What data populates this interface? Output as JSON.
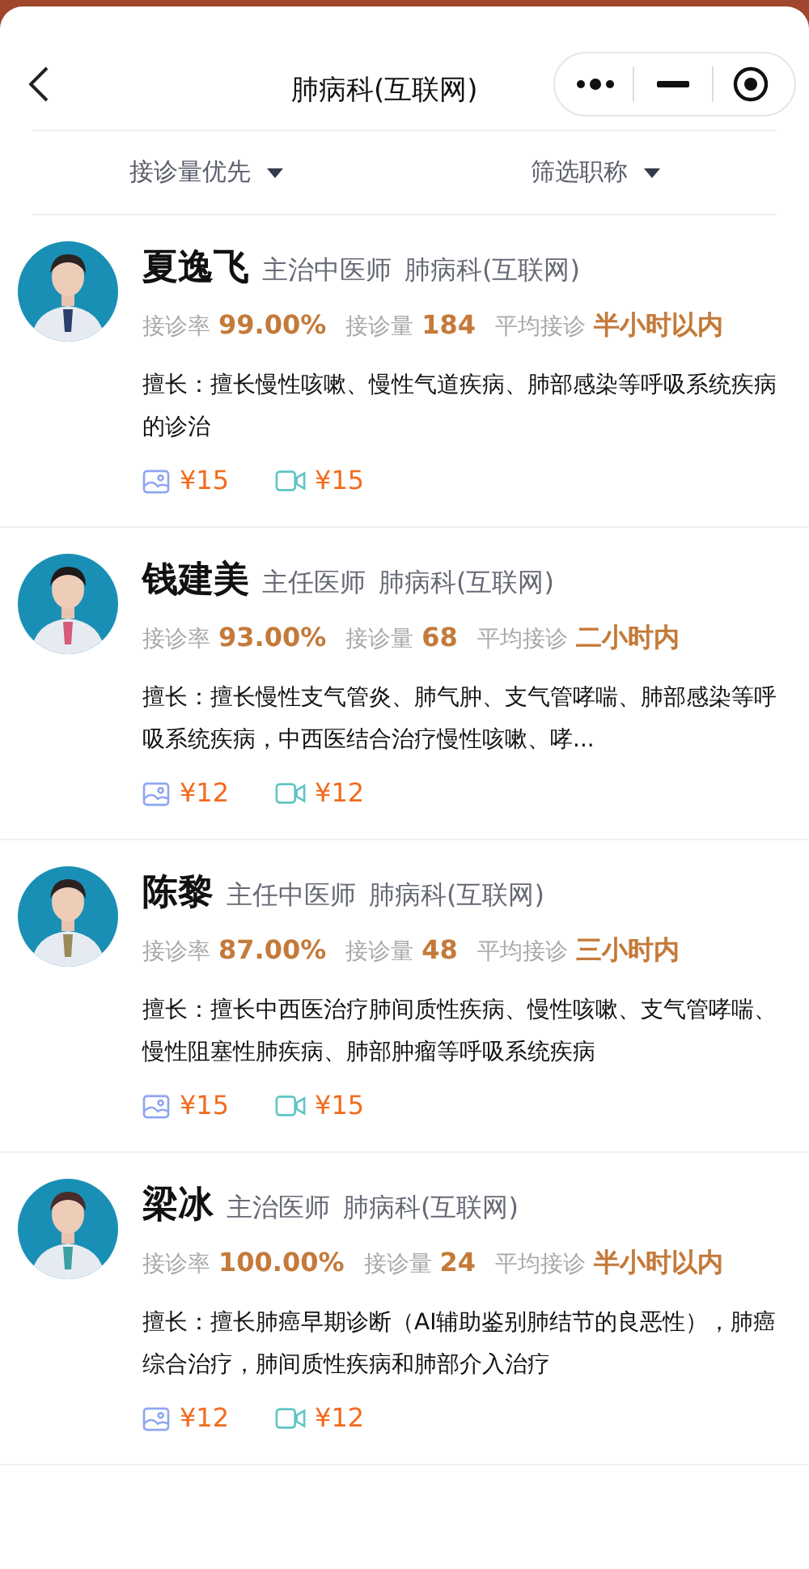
{
  "header": {
    "title": "肺病科(互联网)"
  },
  "filters": [
    {
      "label": "接诊量优先"
    },
    {
      "label": "筛选职称"
    }
  ],
  "doctors": [
    {
      "name": "夏逸飞",
      "title": "主治中医师",
      "department": "肺病科(互联网)",
      "rate_label": "接诊率",
      "rate": "99.00%",
      "count_label": "接诊量",
      "count": "184",
      "wait_label": "平均接诊",
      "wait": "半小时以内",
      "specialty": "擅长：擅长慢性咳嗽、慢性气道疾病、肺部感染等呼吸系统疾病的诊治",
      "image_price": "¥15",
      "video_price": "¥15"
    },
    {
      "name": "钱建美",
      "title": "主任医师",
      "department": "肺病科(互联网)",
      "rate_label": "接诊率",
      "rate": "93.00%",
      "count_label": "接诊量",
      "count": "68",
      "wait_label": "平均接诊",
      "wait": "二小时内",
      "specialty": "擅长：擅长慢性支气管炎、肺气肿、支气管哮喘、肺部感染等呼吸系统疾病，中西医结合治疗慢性咳嗽、哮...",
      "image_price": "¥12",
      "video_price": "¥12"
    },
    {
      "name": "陈黎",
      "title": "主任中医师",
      "department": "肺病科(互联网)",
      "rate_label": "接诊率",
      "rate": "87.00%",
      "count_label": "接诊量",
      "count": "48",
      "wait_label": "平均接诊",
      "wait": "三小时内",
      "specialty": "擅长：擅长中西医治疗肺间质性疾病、慢性咳嗽、支气管哮喘、慢性阻塞性肺疾病、肺部肿瘤等呼吸系统疾病",
      "image_price": "¥15",
      "video_price": "¥15"
    },
    {
      "name": "梁冰",
      "title": "主治医师",
      "department": "肺病科(互联网)",
      "rate_label": "接诊率",
      "rate": "100.00%",
      "count_label": "接诊量",
      "count": "24",
      "wait_label": "平均接诊",
      "wait": "半小时以内",
      "specialty": "擅长：擅长肺癌早期诊断（AI辅助鉴别肺结节的良恶性），肺癌综合治疗，肺间质性疾病和肺部介入治疗",
      "image_price": "¥12",
      "video_price": "¥12"
    }
  ]
}
